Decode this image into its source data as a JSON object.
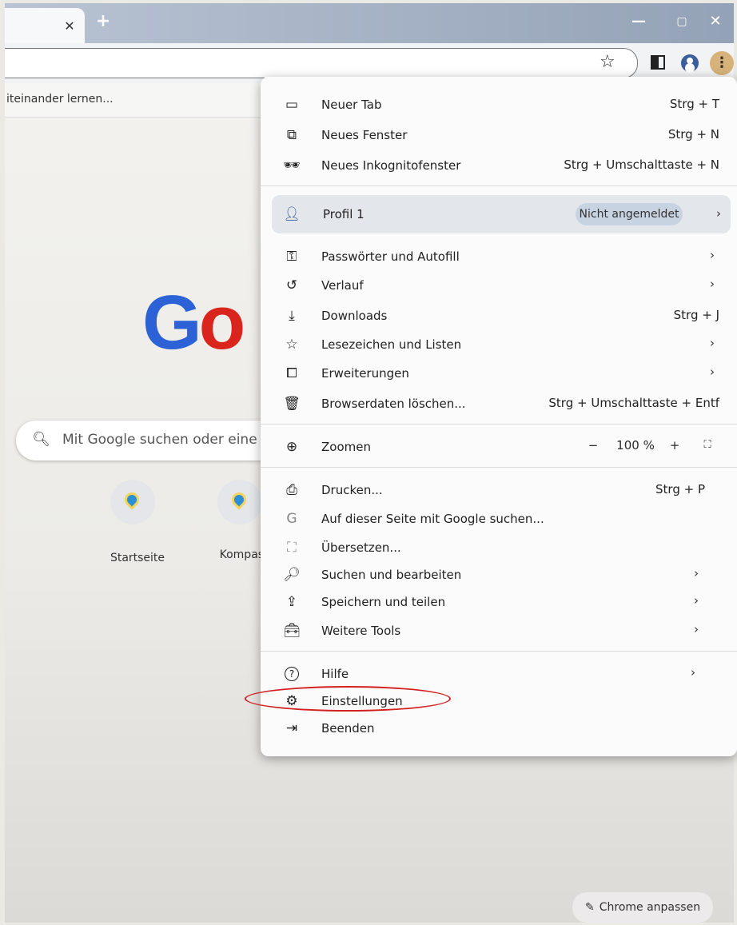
{
  "window": {
    "tab_close_symbol": "✕",
    "new_tab_symbol": "+",
    "minimize_symbol": "—",
    "maximize_symbol": "▢",
    "close_symbol": "✕"
  },
  "toolbar": {
    "star_symbol": "☆",
    "menu_symbol": "⋮"
  },
  "bookmarks": {
    "item_label": "iteinander lernen..."
  },
  "ntp": {
    "logo_g": "G",
    "logo_o": "o",
    "search_symbol": "🔍︎",
    "search_placeholder": "Mit Google suchen oder eine U",
    "shortcuts": [
      {
        "label": "Startseite"
      },
      {
        "label": "Kompass"
      }
    ],
    "customize_label": "Chrome anpassen",
    "customize_icon": "✎"
  },
  "menu": {
    "items": [
      {
        "icon": "new-tab-icon",
        "glyph": "▭",
        "label": "Neuer Tab",
        "shortcut": "Strg + T"
      },
      {
        "icon": "new-window-icon",
        "glyph": "⧉",
        "label": "Neues Fenster",
        "shortcut": "Strg + N"
      },
      {
        "icon": "incognito-icon",
        "glyph": "🕶︎",
        "label": "Neues Inkognitofenster",
        "shortcut": "Strg + Umschalttaste + N"
      },
      {
        "icon": "key-icon",
        "glyph": "⚿",
        "label": "Passwörter und Autofill",
        "shortcut": "›"
      },
      {
        "icon": "history-icon",
        "glyph": "↺",
        "label": "Verlauf",
        "shortcut": "›"
      },
      {
        "icon": "download-icon",
        "glyph": "⤓",
        "label": "Downloads",
        "shortcut": "Strg + J"
      },
      {
        "icon": "bookmark-star-icon",
        "glyph": "☆",
        "label": "Lesezeichen und Listen",
        "shortcut": "›"
      },
      {
        "icon": "extension-icon",
        "glyph": "⧠",
        "label": "Erweiterungen",
        "shortcut": "›"
      },
      {
        "icon": "trash-icon",
        "glyph": "🗑︎",
        "label": "Browserdaten löschen...",
        "shortcut": "Strg + Umschalttaste + Entf"
      },
      {
        "icon": "print-icon",
        "glyph": "⎙",
        "label": "Drucken...",
        "shortcut": "Strg + P"
      },
      {
        "icon": "google-g-icon",
        "glyph": "G",
        "label": "Auf dieser Seite mit Google suchen...",
        "shortcut": ""
      },
      {
        "icon": "translate-icon",
        "glyph": "⛶",
        "label": "Übersetzen...",
        "shortcut": ""
      },
      {
        "icon": "find-icon",
        "glyph": "🔎︎",
        "label": "Suchen und bearbeiten",
        "shortcut": "›"
      },
      {
        "icon": "save-share-icon",
        "glyph": "⇪",
        "label": "Speichern und teilen",
        "shortcut": "›"
      },
      {
        "icon": "toolbox-icon",
        "glyph": "🧰︎",
        "label": "Weitere Tools",
        "shortcut": "›"
      },
      {
        "icon": "help-icon",
        "glyph": "?",
        "label": "Hilfe",
        "shortcut": "›"
      },
      {
        "icon": "settings-gear-icon",
        "glyph": "⚙",
        "label": "Einstellungen",
        "shortcut": ""
      },
      {
        "icon": "exit-icon",
        "glyph": "⇥",
        "label": "Beenden",
        "shortcut": ""
      }
    ],
    "profile": {
      "glyph": "👤︎",
      "label": "Profil 1",
      "status": "Nicht angemeldet",
      "arrow": "›"
    },
    "zoom": {
      "glyph": "⊕",
      "label": "Zoomen",
      "minus": "−",
      "value": "100 %",
      "plus": "+",
      "fullscreen": "⛶"
    }
  },
  "colors": {
    "highlight": "#d22020",
    "google_blue": "#2c62d6",
    "google_red": "#d9251c"
  }
}
